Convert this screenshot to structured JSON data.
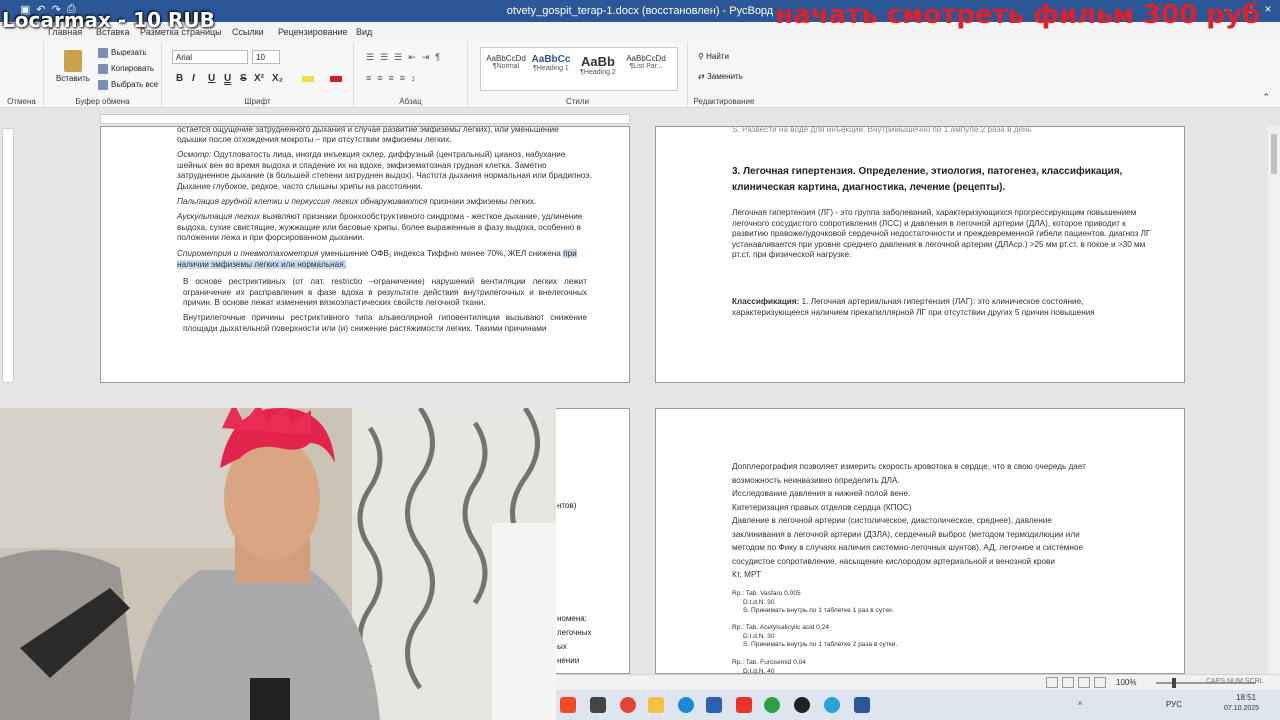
{
  "window": {
    "title": "otvety_gospit_terap-1.docx (восстановлен) - РусВорд",
    "qat_icons": [
      "save-icon",
      "undo-icon",
      "redo-icon",
      "print-icon"
    ]
  },
  "overlay": {
    "streamer_tag": "Locarmax - 10 RUB",
    "promo": "начать смотреть фильм 300 руб"
  },
  "tabs": [
    {
      "label": "Главная"
    },
    {
      "label": "Вставка"
    },
    {
      "label": "Разметка страницы"
    },
    {
      "label": "Ссылки"
    },
    {
      "label": "Рецензирование"
    },
    {
      "label": "Вид"
    }
  ],
  "ribbon": {
    "undo_group": "Отмена",
    "clipboard": {
      "paste": "Вставить",
      "cut": "Вырезать",
      "copy": "Копировать",
      "select_all": "Выбрать все",
      "label": "Буфер обмена"
    },
    "font": {
      "name": "Arial",
      "size": "10",
      "label": "Шрифт",
      "buttons": [
        "B",
        "I",
        "U",
        "U",
        "S",
        "X²",
        "X₂"
      ]
    },
    "paragraph": {
      "label": "Абзац"
    },
    "styles": {
      "label": "Стили",
      "items": [
        {
          "sample": "AaBbCcDd",
          "name": "¶Normal"
        },
        {
          "sample": "AaBbCc",
          "name": "¶Heading 1"
        },
        {
          "sample": "AaBb",
          "name": "¶Heading 2"
        },
        {
          "sample": "AaBbCcDd",
          "name": "¶List Par..."
        }
      ]
    },
    "editing": {
      "find": "Найти",
      "replace": "Заменить",
      "label": "Редактирование"
    }
  },
  "page1": {
    "lines": [
      "остается ощущение затрудненного дыхания и случае развитие эмфиземы легких), или уменьшение",
      "одышки после отхождения мокроты – при отсутствии эмфиземы легких."
    ],
    "osmotr_label": "Осмотр:",
    "osmotr_text": "Одутловатость лица, иногда инъекция склер, диффузный (центральный) цианоз, набухание шейных вен во время выдоха и спадение их на вдохе, эмфизематозная грудная клетка. Заметно затрудненное дыхание (в большей степени затруднен выдох). Частота дыхания нормальная или брадипноэ. Дыхание глубокое, редкое, часто слышны хрипы на расстоянии.",
    "palpation": "Пальпация грудной клетки и перкуссия легких обнаруживаются",
    "palpation_rest": "признаки эмфиземы легких.",
    "auscultation_label": "Аускультация легких",
    "auscultation_text": "выявляют признаки бронхообструктивного синдрома - жесткое дыхание, удлинение выдоха, сухие свистящие, жужжащие или басовые хрипы, более выраженные в фазу выдоха, особенно в положении лежа и при форсированном дыхании.",
    "spiro_label": "Спирометрия и пневмотахометрия",
    "spiro_text": "уменьшение ОФВ₁ индекса Тиффно менее 70%, ЖЕЛ снижена",
    "spiro_highlight": "при наличии эмфиземы легких или нормальная.",
    "restrict_text": "В основе рестриктивных (от лат. restrictio –ограничение) нарушений вентиляции легких лежит ограничение их расправления в фазе вдоха в результате действия внутрилегочных и внелегочных причин. В основе лежат изменения вязкоэластических свойств легочной ткани.",
    "intra_text": "Внутрилегочные причины рестриктивного типа альвеолярной гиповентиляции вызывают снижение площади дыхательной поверхности или (и) снижение растяжимости легких. Такими причинами"
  },
  "page2": {
    "top_line": "S. Развести на воде для инъекций. Внутримышечно по 1 ампуле 2 раза в день",
    "heading": "3. Легочная гипертензия. Определение, этиология, патогенез, классификация, клиническая картина, диагностика, лечение (рецепты).",
    "definition": "Легочная гипертензия (ЛГ) - это группа заболеваний, характеризующихся прогрессирующим повышением легочного сосудистого сопротивления (ЛСС) и давления в легочной артерии (ДЛА), которое приводит к развитию правожелудочковой сердечной недостаточности и преждевременной гибели пациентов. диагноз ЛГ устанавливается при уровне среднего давления в легочной артерии (ДЛАср.) >25 мм рт.ст. в покое и >30 мм рт.ст. при физической нагрузке.",
    "class_label": "Классификация:",
    "class_text": "1. Легочная артериальная гипертензия (ЛАГ): это клиническое состояние, характеризующееся наличием прекапиллярной ЛГ при отсутствии других 5 причин повышения"
  },
  "page4": {
    "lines": [
      "Допплерография позволяет измерить скорость кровотока в сердце, что в свою очередь дает",
      "возможность неинвазивно определить ДЛА.",
      "Исследование давления в нижней полой вене.",
      "Катетеризация правых отделов сердца (КПОС)",
      "Давление в легочной артерии (систолическое, диастолическое, среднее), давление",
      "заклинивания в легочной артерии (ДЗЛА), сердечный выброс (методом термодилюции или",
      "методом по Фику в случаях наличия системно-легочных шунтов), АД, легочное и системное",
      "сосудистое сопротивление, насыщение кислородом артериальной и венозной крови",
      "Кт, МРТ"
    ],
    "rx": [
      "Rp.: Tab. Vasfaru 0,005\n      D.t.d.N. 30\n      S. Принимать внутрь по 1 таблетке 1 раз в сутки.",
      "Rp.: Tab. Acetylsalicylic acid 0,24\n      D.t.d.N. 30\n      S. Принимать внутрь по 1 таблетке 2 раза в сутки.",
      "Rp.: Tab. Furosemid 0,04\n      D.t.d.N. 40"
    ]
  },
  "page3_fragments": [
    "нтов)",
    "номена:",
    "легочных",
    "ых",
    "нении"
  ],
  "statusbar": {
    "zoom": "100%"
  },
  "taskbar": {
    "lang": "РУС",
    "time": "18:51",
    "date": "07.10.2025",
    "indicators": "CAPS  NUM  SCRL"
  }
}
